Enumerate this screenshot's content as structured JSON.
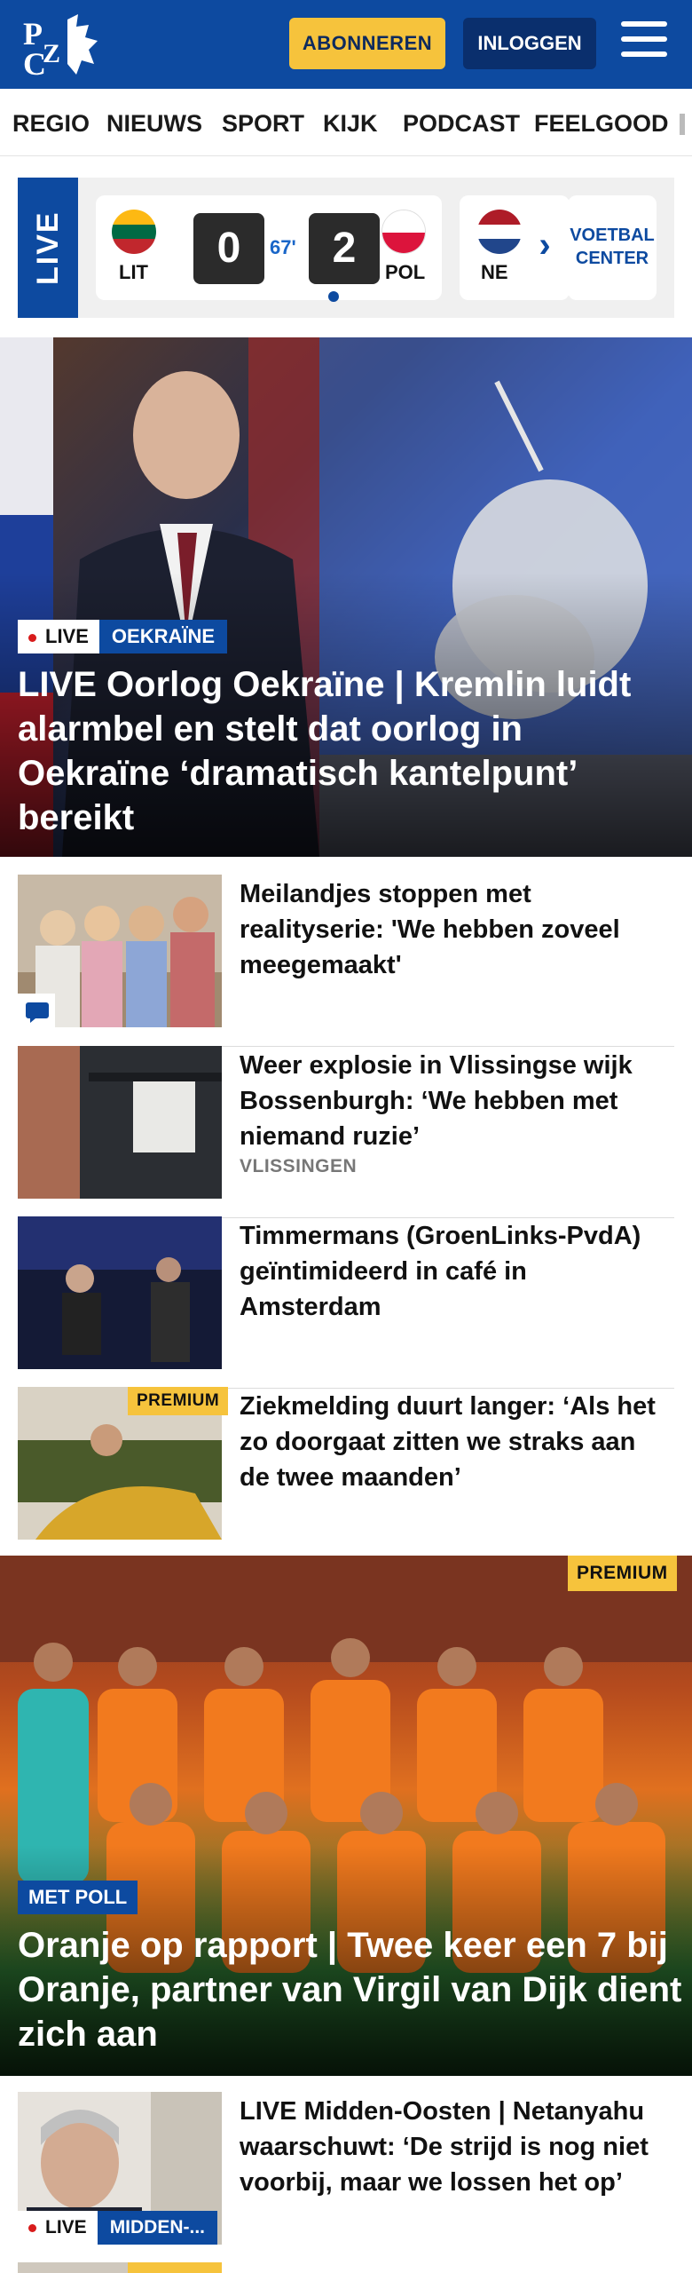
{
  "header": {
    "logo_text": "PZC",
    "subscribe_label": "ABONNEREN",
    "login_label": "INLOGGEN"
  },
  "nav": {
    "items": [
      "REGIO",
      "NIEUWS",
      "SPORT",
      "KIJK",
      "PODCAST",
      "FEELGOOD"
    ]
  },
  "live": {
    "tag": "LIVE",
    "match": {
      "home_code": "LIT",
      "home_score": "0",
      "minute": "67'",
      "away_score": "2",
      "away_code": "POL"
    },
    "next_match_code": "NE",
    "voetbal_center_label": "VOETBAL CENTER"
  },
  "hero": {
    "badge_live": "LIVE",
    "badge_category": "OEKRAÏNE",
    "title": "LIVE Oorlog Oekraïne | Kremlin luidt alarmbel en stelt dat oorlog in Oekraïne ‘dramatisch kantelpunt’ bereikt"
  },
  "articles": [
    {
      "title": "Meilandjes stoppen met realityserie: 'We hebben zoveel meegemaakt'"
    },
    {
      "title": "Weer explosie in Vlissingse wijk Bossenburgh: ‘We hebben met niemand ruzie’",
      "location": "VLISSINGEN"
    },
    {
      "title": "Timmermans (GroenLinks-PvdA) geïntimideerd in café in Amsterdam"
    },
    {
      "title": "Ziekmelding duurt langer: ‘Als het zo doorgaat zitten we straks aan de twee maanden’",
      "premium": "PREMIUM"
    }
  ],
  "feature": {
    "premium": "PREMIUM",
    "badge": "MET POLL",
    "title": "Oranje op rapport | Twee keer een 7 bij Oranje, partner van Virgil van Dijk dient zich aan"
  },
  "bottom_article": {
    "title": "LIVE Midden-Oosten | Netanyahu waarschuwt: ‘De strijd is nog niet voorbij, maar we lossen het op’",
    "badge_live": "LIVE",
    "badge_category": "MIDDEN-..."
  },
  "colors": {
    "brand_blue": "#0d4aa0",
    "accent_yellow": "#f6c33c",
    "live_red": "#d81b1b"
  }
}
